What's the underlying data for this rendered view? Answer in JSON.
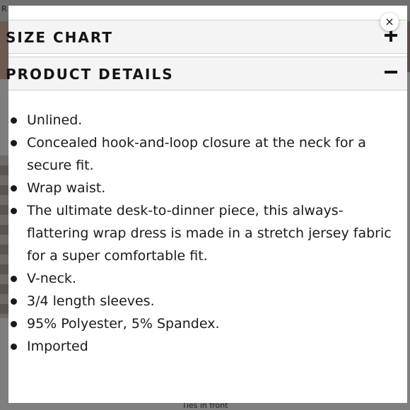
{
  "background": {
    "topbar_text": "R D",
    "caption": "Ties in front"
  },
  "modal": {
    "close_icon": "×",
    "size_chart": {
      "title": "SIZE CHART",
      "toggle_icon": "plus-icon",
      "expanded": false
    },
    "product_details": {
      "title": "PRODUCT DETAILS",
      "toggle_icon": "minus-icon",
      "expanded": true,
      "items": [
        "Unlined.",
        "Concealed hook-and-loop closure at the neck for a secure fit.",
        "Wrap waist.",
        "The ultimate desk-to-dinner piece, this always-flattering wrap dress is made in a stretch jersey fabric for a super comfortable fit.",
        "V-neck.",
        "3/4 length sleeves.",
        "95% Polyester, 5% Spandex.",
        "Imported"
      ]
    }
  }
}
